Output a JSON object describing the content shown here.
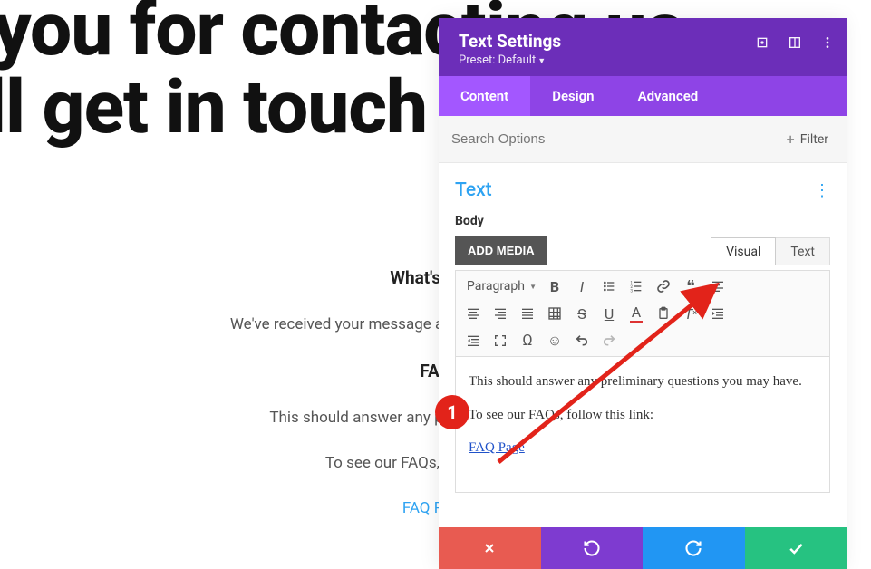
{
  "background": {
    "big_heading_line1": "k you for contacting us.",
    "big_heading_line2": "e'll get in touch",
    "whats_next_heading": "What's Next",
    "whats_next_text": "We've received your message and we'll send you an email wi",
    "faq_heading": "FAQ",
    "faq_text": "This should answer any preliminary questions yo",
    "faq_link_prompt": "To see our FAQs, follow this link:",
    "faq_link_label": "FAQ Page"
  },
  "annotation": {
    "badge": "1"
  },
  "panel": {
    "title": "Text Settings",
    "preset": "Preset: Default",
    "tabs": {
      "content": "Content",
      "design": "Design",
      "advanced": "Advanced"
    },
    "search_placeholder": "Search Options",
    "filter_label": "Filter",
    "section_title": "Text",
    "body_label": "Body",
    "add_media": "ADD MEDIA",
    "editor_tabs": {
      "visual": "Visual",
      "text": "Text"
    },
    "format_select": "Paragraph",
    "editor": {
      "p1": "This should answer any preliminary questions you may have.",
      "p2": "To see our FAQs, follow this link:",
      "link_text": "FAQ Page"
    }
  }
}
